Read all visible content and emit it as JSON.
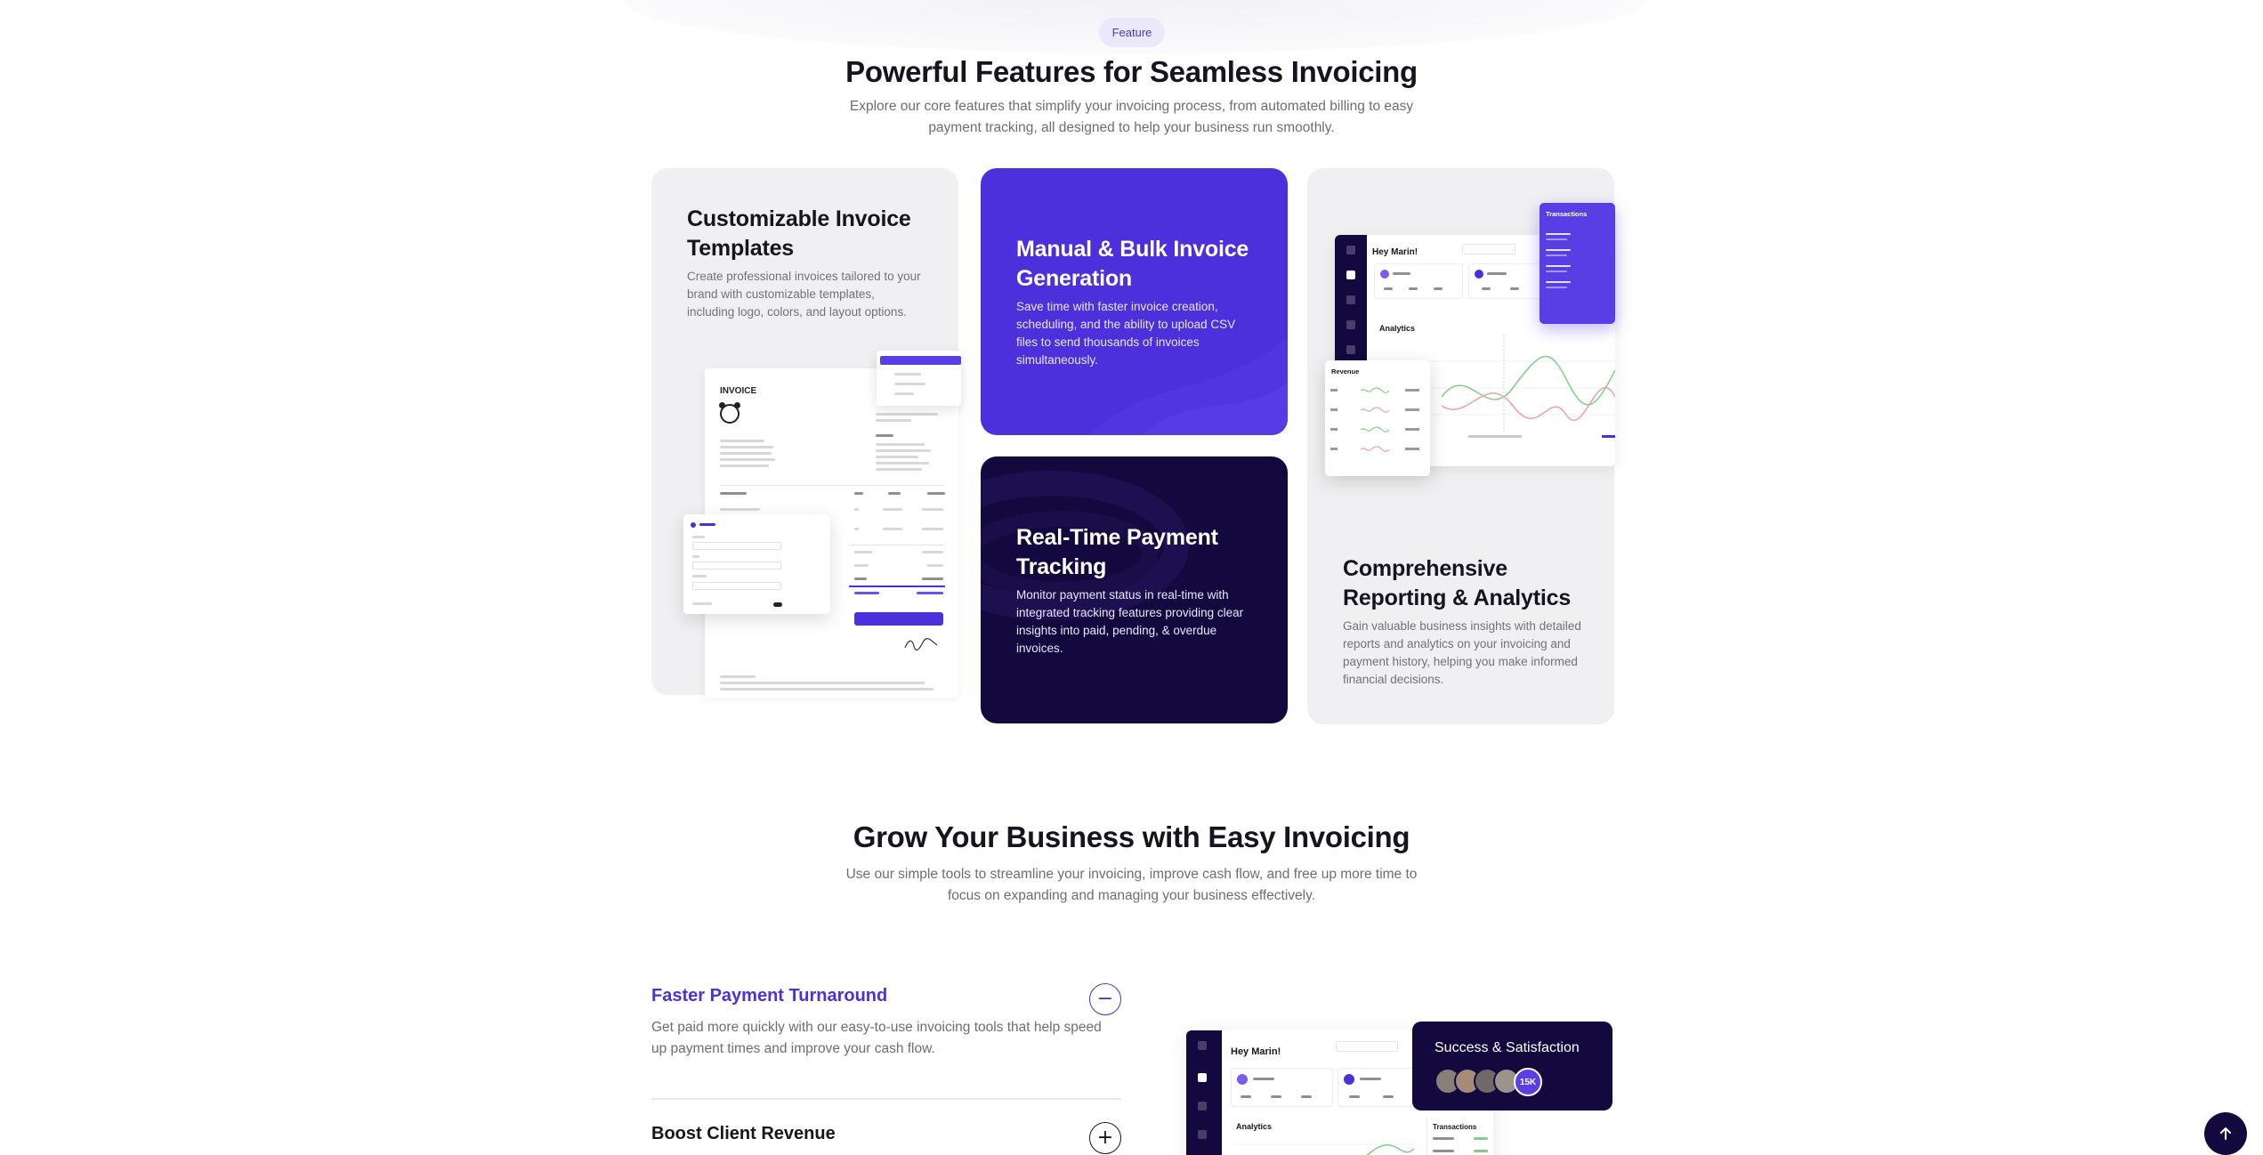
{
  "features_section": {
    "badge": "Feature",
    "title": "Powerful Features for Seamless Invoicing",
    "subtitle": "Explore our core features that simplify your invoicing process, from automated billing to easy payment tracking, all designed to help your business run smoothly.",
    "cards": [
      {
        "title": "Customizable Invoice Templates",
        "description": "Create professional invoices tailored to your brand with customizable templates, including logo, colors, and layout options."
      },
      {
        "title": "Manual & Bulk Invoice Generation",
        "description": "Save time with faster invoice creation, scheduling, and the ability to upload CSV files to send thousands of invoices simultaneously."
      },
      {
        "title": "Real-Time Payment Tracking",
        "description": "Monitor payment status in real-time with integrated tracking features providing clear insights into paid, pending, & overdue invoices."
      },
      {
        "title": "Comprehensive Reporting & Analytics",
        "description": "Gain valuable business insights with detailed reports and analytics on your invoicing and payment history, helping you make informed financial decisions."
      }
    ],
    "invoice_mock": {
      "heading": "INVOICE"
    },
    "dashboard_mock": {
      "greeting": "Hey Marin!",
      "analytics_label": "Analytics",
      "transactions_label": "Transactions",
      "revenue_label": "Revenue"
    }
  },
  "growth_section": {
    "title": "Grow Your Business with Easy Invoicing",
    "subtitle": "Use our simple tools to streamline your invoicing, improve cash flow, and free up more time to focus on expanding and managing your business effectively.",
    "accordion": [
      {
        "title": "Faster Payment Turnaround",
        "description": "Get paid more quickly with our easy-to-use invoicing tools that help speed up payment times and improve your cash flow.",
        "expanded": true,
        "toggle_symbol": "−"
      },
      {
        "title": "Boost Client Revenue",
        "expanded": false,
        "toggle_symbol": "+"
      }
    ],
    "dashboard_mock": {
      "greeting": "Hey Marin!",
      "analytics_label": "Analytics",
      "transactions_label": "Transactions"
    },
    "social_proof": {
      "title": "Success & Satisfaction",
      "count": "15K"
    }
  },
  "icons": {
    "back_to_top": "arrow-up-icon"
  },
  "colors": {
    "brand_purple": "#4c30dc",
    "dark_navy": "#14093f",
    "card_gray": "#f0f0f2",
    "badge_bg": "#ebe8fb"
  }
}
